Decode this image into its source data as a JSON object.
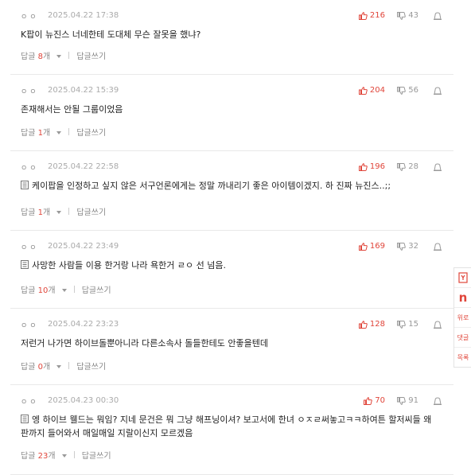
{
  "comments": [
    {
      "nick": "ㅇㅇ",
      "date": "2025.04.22 17:38",
      "up": "216",
      "down": "43",
      "has_doc": false,
      "text": "K팝이 뉴진스 너네한테 도대체 무슨 잘못을 했냐?",
      "reply_label": "답글",
      "reply_num": "8",
      "reply_unit": "개",
      "write": "답글쓰기"
    },
    {
      "nick": "ㅇㅇ",
      "date": "2025.04.22 15:39",
      "up": "204",
      "down": "56",
      "has_doc": false,
      "text": "존재해서는 안될 그룹이었음",
      "reply_label": "답글",
      "reply_num": "1",
      "reply_unit": "개",
      "write": "답글쓰기"
    },
    {
      "nick": "ㅇㅇ",
      "date": "2025.04.22 22:58",
      "up": "196",
      "down": "28",
      "has_doc": true,
      "text": "케이팝을 인정하고 싶지 않은 서구언론에게는 정말 까내리기 좋은 아이템이겠지. 하 진짜 뉴진스..;;",
      "reply_label": "답글",
      "reply_num": "1",
      "reply_unit": "개",
      "write": "답글쓰기"
    },
    {
      "nick": "ㅇㅇ",
      "date": "2025.04.22 23:49",
      "up": "169",
      "down": "32",
      "has_doc": true,
      "text": "사망한 사람들 이용 한거랑 나라 욕한거 ㄹㅇ 선 넘음.",
      "reply_label": "답글",
      "reply_num": "10",
      "reply_unit": "개",
      "write": "답글쓰기"
    },
    {
      "nick": "ㅇㅇ",
      "date": "2025.04.22 23:23",
      "up": "128",
      "down": "15",
      "has_doc": false,
      "text": "저런거 나가면 하이브돌뿐아니라 다른소속사 돌들한테도 안좋을텐데",
      "reply_label": "답글",
      "reply_num": "0",
      "reply_unit": "개",
      "write": "답글쓰기"
    },
    {
      "nick": "ㅇㅇ",
      "date": "2025.04.23 00:30",
      "up": "70",
      "down": "91",
      "has_doc": true,
      "text": "엥 하이브 웰드는 뭐임? 지네 문건은 뭐 그냥 해프닝이셔? 보고서에 한녀 ㅇㅈㄹ써놓고ㅋㅋ하여튼 할저씨들 왜 판까지 들어와서 매일매일 지랄이신지 모르겠음",
      "reply_label": "답글",
      "reply_num": "23",
      "reply_unit": "개",
      "write": "답글쓰기"
    }
  ],
  "sidebar": {
    "n_logo": "n",
    "top_label": "위로",
    "comment_label": "댓글",
    "list_label": "목록"
  },
  "colors": {
    "accent": "#e0453a",
    "muted": "#999999",
    "divider": "#e9e9e9"
  }
}
